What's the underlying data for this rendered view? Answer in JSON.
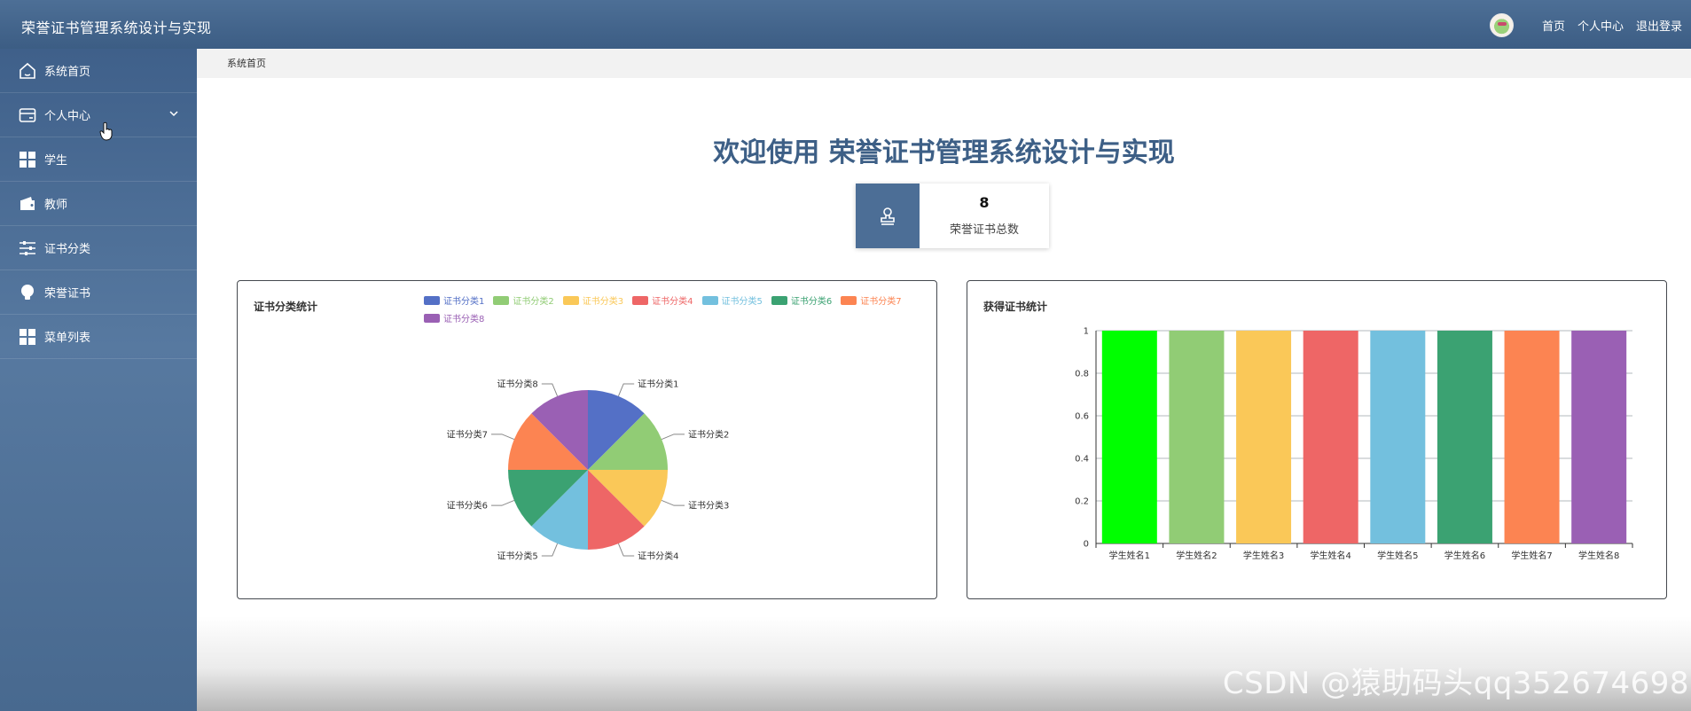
{
  "header": {
    "title": "荣誉证书管理系统设计与实现",
    "links": [
      "首页",
      "个人中心",
      "退出登录"
    ]
  },
  "sidebar": {
    "items": [
      {
        "label": "系统首页",
        "icon": "home-icon"
      },
      {
        "label": "个人中心",
        "icon": "card-icon",
        "expandable": true
      },
      {
        "label": "学生",
        "icon": "grid-icon"
      },
      {
        "label": "教师",
        "icon": "wallet-icon"
      },
      {
        "label": "证书分类",
        "icon": "sliders-icon"
      },
      {
        "label": "荣誉证书",
        "icon": "bulb-icon"
      },
      {
        "label": "菜单列表",
        "icon": "grid-icon"
      }
    ]
  },
  "breadcrumb": "系统首页",
  "welcome": "欢迎使用 荣誉证书管理系统设计与实现",
  "stat": {
    "value": "8",
    "label": "荣誉证书总数"
  },
  "colors": {
    "header": "#44658c",
    "accent": "#3d5f86",
    "palette": [
      "#5470c6",
      "#91cc75",
      "#fac858",
      "#ee6666",
      "#73c0de",
      "#3ba272",
      "#fc8452",
      "#9a60b4"
    ],
    "bar_first": "#00ff00"
  },
  "watermark": "CSDN @猿助码头qq352674698",
  "chart_data": [
    {
      "type": "pie",
      "title": "证书分类统计",
      "categories": [
        "证书分类1",
        "证书分类2",
        "证书分类3",
        "证书分类4",
        "证书分类5",
        "证书分类6",
        "证书分类7",
        "证书分类8"
      ],
      "values": [
        1,
        1,
        1,
        1,
        1,
        1,
        1,
        1
      ],
      "legend": "top"
    },
    {
      "type": "bar",
      "title": "获得证书统计",
      "categories": [
        "学生姓名1",
        "学生姓名2",
        "学生姓名3",
        "学生姓名4",
        "学生姓名5",
        "学生姓名6",
        "学生姓名7",
        "学生姓名8"
      ],
      "values": [
        1,
        1,
        1,
        1,
        1,
        1,
        1,
        1
      ],
      "yticks": [
        "0",
        "0.2",
        "0.4",
        "0.6",
        "0.8",
        "1"
      ],
      "ylim": [
        0,
        1
      ],
      "grid": true
    }
  ]
}
